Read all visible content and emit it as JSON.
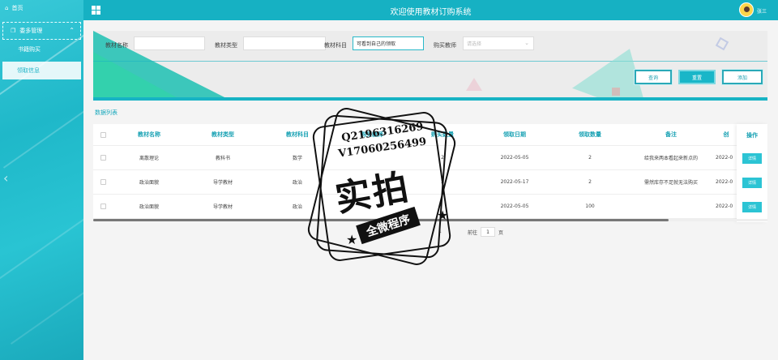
{
  "header": {
    "title": "欢迎使用教材订购系统",
    "user": "张三"
  },
  "sidebar": {
    "home": "首页",
    "group": "委多管理",
    "items": [
      {
        "label": "书籍购买"
      },
      {
        "label": "领取信息"
      }
    ]
  },
  "search": {
    "fields": [
      {
        "label": "教材名称",
        "value": "",
        "placeholder": ""
      },
      {
        "label": "教材类型",
        "value": "",
        "placeholder": ""
      },
      {
        "label": "教材科目",
        "value": "可看到自己的领取",
        "placeholder": ""
      },
      {
        "label": "购买教师",
        "value": "",
        "placeholder": "请选择"
      }
    ],
    "buttons": {
      "query": "查询",
      "reset": "重置",
      "add": "添加"
    }
  },
  "table": {
    "section_title": "数据列表",
    "columns": [
      "教材名称",
      "教材类型",
      "教材科目",
      "购买教师",
      "购买数量",
      "领取日期",
      "领取数量",
      "备注",
      "创",
      "操作"
    ],
    "rows": [
      {
        "name": "离散理论",
        "type": "教科书",
        "subject": "数学",
        "teacher": "",
        "qty": "2",
        "date": "2022-05-05",
        "received": "2",
        "note": "给我来两本看起来新点的",
        "created": "2022-0",
        "action": "详情"
      },
      {
        "name": "政治面貌",
        "type": "导学教材",
        "subject": "政治",
        "teacher": "",
        "qty": "2",
        "date": "2022-05-17",
        "received": "2",
        "note": "需然库存不足就无法购买",
        "created": "2022-0",
        "action": "详情"
      },
      {
        "name": "政治面貌",
        "type": "导学教材",
        "subject": "政治",
        "teacher": "",
        "qty": "",
        "date": "2022-05-05",
        "received": "100",
        "note": "",
        "created": "2022-0",
        "action": "详情"
      }
    ]
  },
  "pager": {
    "current": "1",
    "goto_prefix": "前往",
    "goto_value": "1",
    "goto_suffix": "页"
  },
  "watermark": {
    "qq": "Q2196316269",
    "vx": "V17060256499",
    "big": "实拍",
    "ribbon": "全微程序"
  },
  "colors": {
    "primary": "#16b1c3",
    "accent": "#2cc4d4"
  }
}
